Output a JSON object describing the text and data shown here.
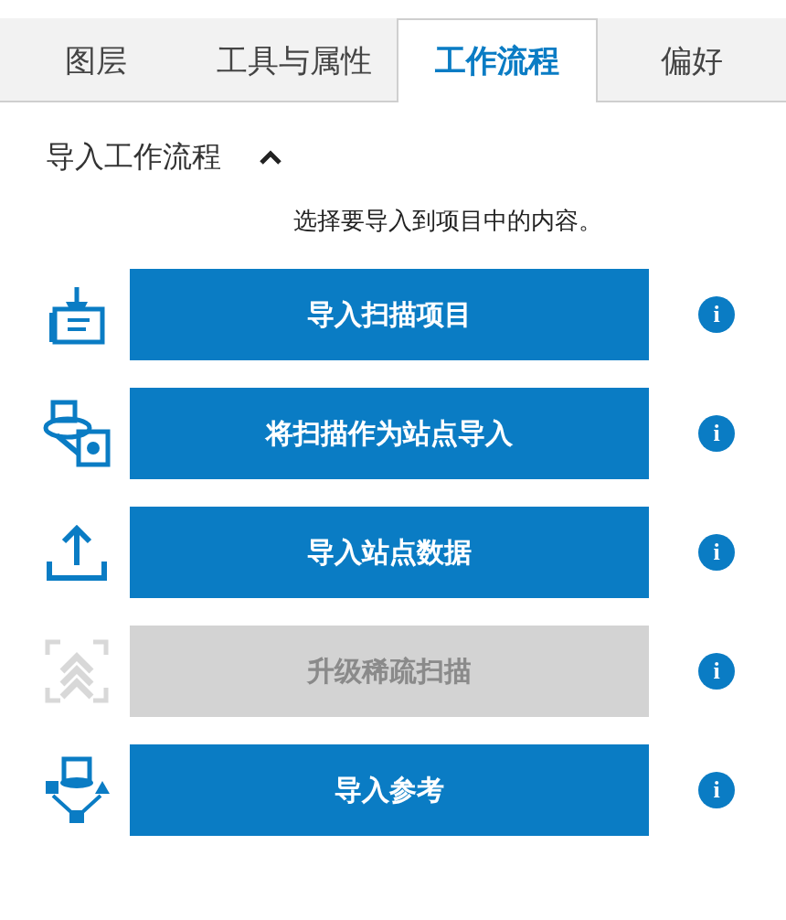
{
  "tabs": [
    {
      "label": "图层",
      "selected": false
    },
    {
      "label": "工具与属性",
      "selected": false
    },
    {
      "label": "工作流程",
      "selected": true
    },
    {
      "label": "偏好",
      "selected": false
    }
  ],
  "section": {
    "title": "导入工作流程",
    "expanded": true,
    "description": "选择要导入到项目中的内容。"
  },
  "actions": [
    {
      "kind": "scan",
      "label": "导入扫描项目",
      "disabled": false,
      "info": "i"
    },
    {
      "kind": "station",
      "label": "将扫描作为站点导入",
      "disabled": false,
      "info": "i"
    },
    {
      "kind": "upload",
      "label": "导入站点数据",
      "disabled": false,
      "info": "i"
    },
    {
      "kind": "upgrade",
      "label": "升级稀疏扫描",
      "disabled": true,
      "info": "i"
    },
    {
      "kind": "reference",
      "label": "导入参考",
      "disabled": false,
      "info": "i"
    }
  ]
}
